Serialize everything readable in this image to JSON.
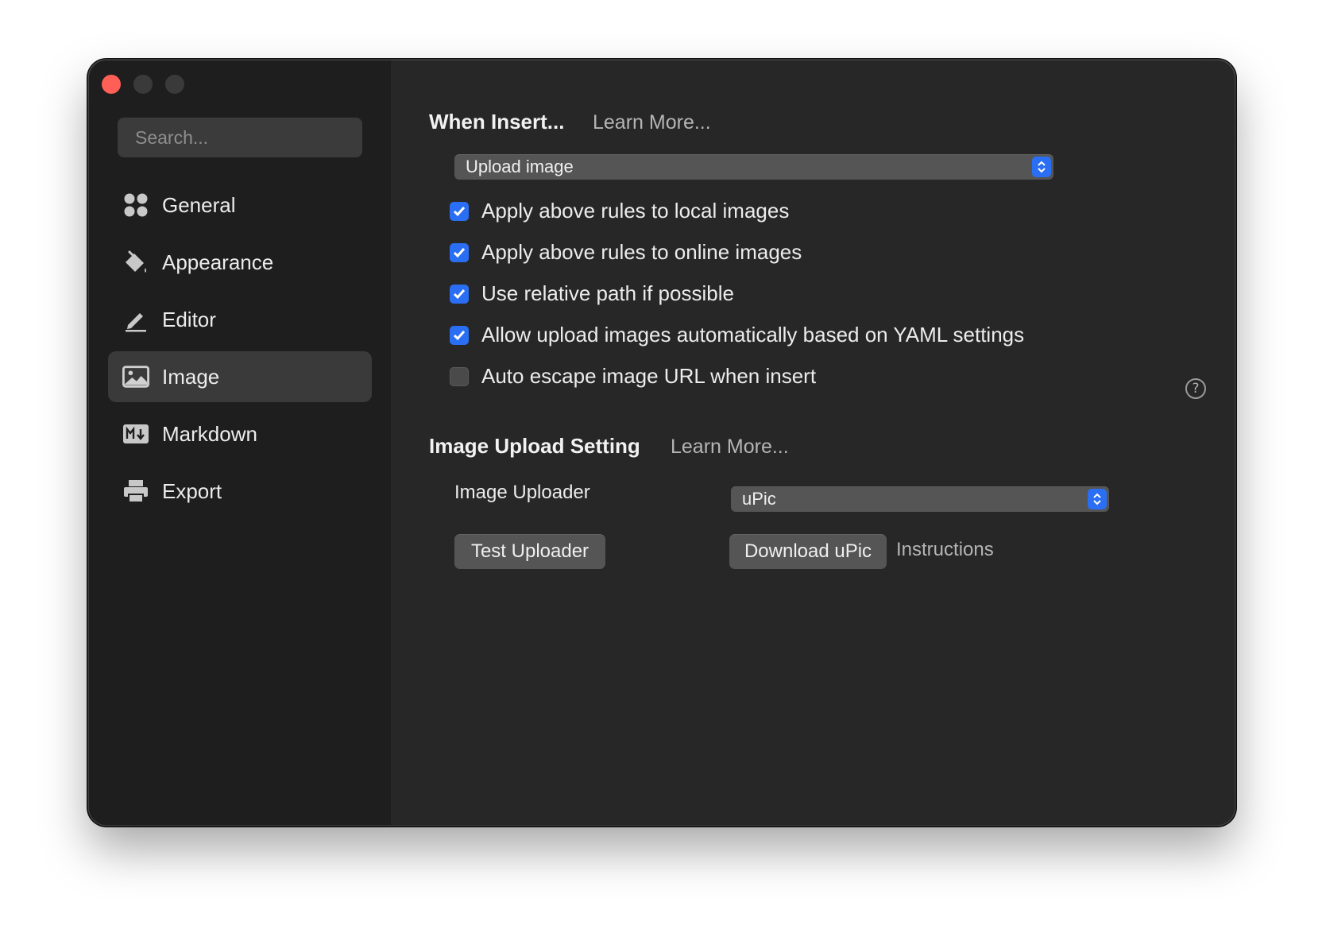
{
  "window": {
    "controls": [
      "close",
      "minimize",
      "zoom"
    ]
  },
  "sidebar": {
    "search_placeholder": "Search...",
    "items": [
      {
        "label": "General",
        "icon": "grid-icon"
      },
      {
        "label": "Appearance",
        "icon": "paint-bucket-icon"
      },
      {
        "label": "Editor",
        "icon": "pencil-icon"
      },
      {
        "label": "Image",
        "icon": "image-icon",
        "active": true
      },
      {
        "label": "Markdown",
        "icon": "markdown-icon"
      },
      {
        "label": "Export",
        "icon": "printer-icon"
      }
    ]
  },
  "insert_section": {
    "title": "When Insert...",
    "learn_more": "Learn More...",
    "action_select": "Upload image",
    "options": [
      {
        "label": "Apply above rules to local images",
        "checked": true
      },
      {
        "label": "Apply above rules to online images",
        "checked": true
      },
      {
        "label": "Use relative path if possible",
        "checked": true
      },
      {
        "label": "Allow upload images automatically based on YAML settings",
        "checked": true
      },
      {
        "label": "Auto escape image URL when insert",
        "checked": false
      }
    ],
    "help": "?"
  },
  "upload_section": {
    "title": "Image Upload Setting",
    "learn_more": "Learn More...",
    "uploader_label": "Image Uploader",
    "uploader_select": "uPic",
    "test_button": "Test Uploader",
    "download_button": "Download uPic",
    "instructions_link": "Instructions"
  },
  "colors": {
    "accent": "#2a6ef3",
    "close": "#fe5f57",
    "sidebar_bg": "#1e1e1e",
    "content_bg": "#272727"
  }
}
